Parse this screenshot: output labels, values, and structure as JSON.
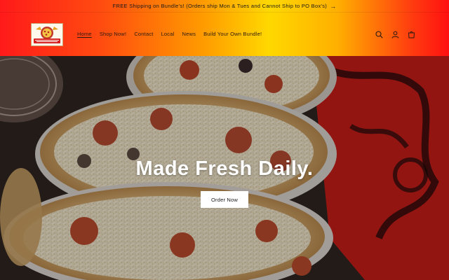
{
  "announcement": {
    "text": "FREE Shipping on Bundle's! (Orders ship Mon & Tues and Cannot Ship to PO Box's)",
    "arrow": "→"
  },
  "header": {
    "nav": [
      {
        "label": "Home",
        "active": true
      },
      {
        "label": "Shop Now!",
        "active": false
      },
      {
        "label": "Contact",
        "active": false
      },
      {
        "label": "Local",
        "active": false
      },
      {
        "label": "News",
        "active": false
      },
      {
        "label": "Build Your Own Bundle!",
        "active": false
      }
    ],
    "icons": [
      "search-icon",
      "account-icon",
      "cart-icon"
    ]
  },
  "hero": {
    "title": "Made Fresh Daily.",
    "button_label": "Order Now"
  },
  "colors": {
    "header_gradient_start": "#ff1a1a",
    "header_gradient_mid": "#ffd800",
    "header_gradient_end": "#ff1010",
    "button_bg": "#ffffff"
  }
}
